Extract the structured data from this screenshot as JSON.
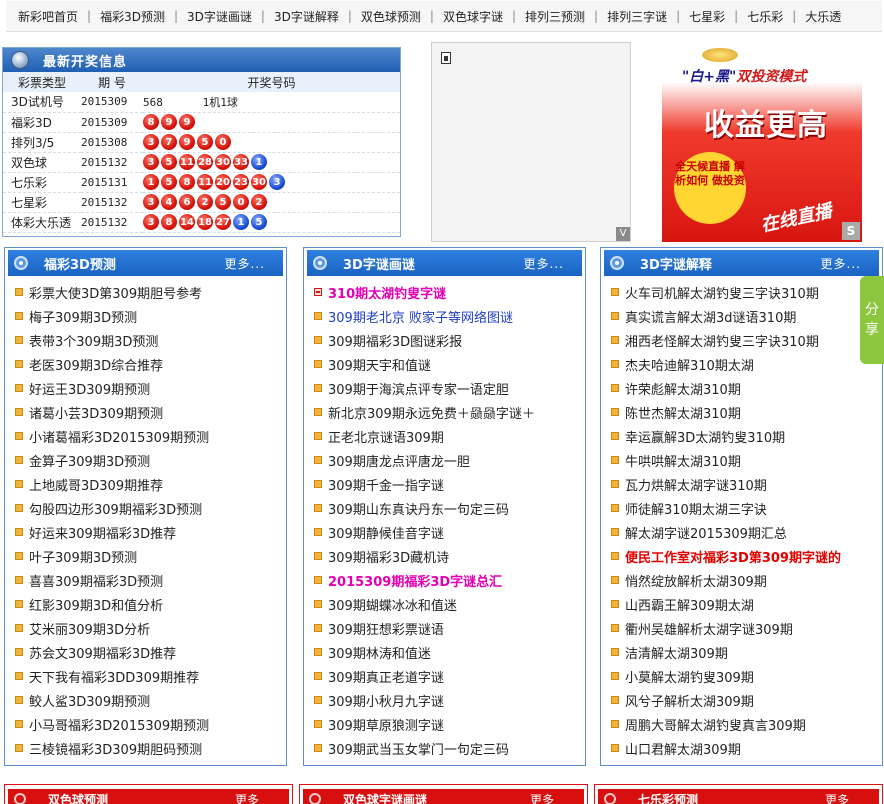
{
  "nav": {
    "items": [
      "新彩吧首页",
      "福彩3D预测",
      "3D字谜画谜",
      "3D字谜解释",
      "双色球预测",
      "双色球字谜",
      "排列三预测",
      "排列三字谜",
      "七星彩",
      "七乐彩",
      "大乐透"
    ],
    "separator": "|"
  },
  "draw_box": {
    "title": "最新开奖信息",
    "headers": [
      "彩票类型",
      "期  号",
      "开奖号码"
    ],
    "rows": [
      {
        "type": "3D试机号",
        "issue": "2015309",
        "plain": "568      1机1球",
        "red": [],
        "blue": []
      },
      {
        "type": "福彩3D",
        "issue": "2015309",
        "plain": "",
        "red": [
          "8",
          "9",
          "9"
        ],
        "blue": []
      },
      {
        "type": "排列3/5",
        "issue": "2015308",
        "plain": "",
        "red": [
          "3",
          "7",
          "9",
          "5",
          "0"
        ],
        "blue": []
      },
      {
        "type": "双色球",
        "issue": "2015132",
        "plain": "",
        "red": [
          "3",
          "5",
          "11",
          "28",
          "30",
          "33"
        ],
        "blue": [
          "1"
        ]
      },
      {
        "type": "七乐彩",
        "issue": "2015131",
        "plain": "",
        "red": [
          "1",
          "5",
          "8",
          "11",
          "20",
          "23",
          "30"
        ],
        "blue": [
          "3"
        ]
      },
      {
        "type": "七星彩",
        "issue": "2015132",
        "plain": "",
        "red": [
          "3",
          "4",
          "6",
          "2",
          "5",
          "0",
          "2"
        ],
        "blue": []
      },
      {
        "type": "体彩大乐透",
        "issue": "2015132",
        "plain": "",
        "red": [
          "3",
          "8",
          "14",
          "18",
          "27"
        ],
        "blue": [
          "1",
          "5"
        ]
      }
    ],
    "ball_colors": {
      "red": "#d8150d",
      "blue": "#1b4fd6"
    }
  },
  "ad": {
    "top_quote": "\"白+黑\"",
    "top_rest": "双投资模式",
    "headline": "收益更高",
    "circle_text": "全天候直播 解析如何 做投资",
    "live": "在线直播",
    "badge": "S"
  },
  "mid_frame": {
    "corner": "V"
  },
  "panels": [
    {
      "title": "福彩3D预测",
      "more": "更多...",
      "items": [
        {
          "text": "彩票大使3D第309期胆号参考",
          "style": ""
        },
        {
          "text": "梅子309期3D预测",
          "style": ""
        },
        {
          "text": "表带3个309期3D预测",
          "style": ""
        },
        {
          "text": "老医309期3D综合推荐",
          "style": ""
        },
        {
          "text": "好运王3D309期预测",
          "style": ""
        },
        {
          "text": "诸葛小芸3D309期预测",
          "style": ""
        },
        {
          "text": "小诸葛福彩3D2015309期预测",
          "style": ""
        },
        {
          "text": "金算子309期3D预测",
          "style": ""
        },
        {
          "text": "上地威哥3D309期推荐",
          "style": ""
        },
        {
          "text": "勾股四边形309期福彩3D预测",
          "style": ""
        },
        {
          "text": "好运来309期福彩3D推荐",
          "style": ""
        },
        {
          "text": "叶子309期3D预测",
          "style": ""
        },
        {
          "text": "喜喜309期福彩3D预测",
          "style": ""
        },
        {
          "text": "红影309期3D和值分析",
          "style": ""
        },
        {
          "text": "艾米丽309期3D分析",
          "style": ""
        },
        {
          "text": "苏会文309期福彩3D推荐",
          "style": ""
        },
        {
          "text": "天下我有福彩3DD309期推荐",
          "style": ""
        },
        {
          "text": "鲛人鲨3D309期预测",
          "style": ""
        },
        {
          "text": "小马哥福彩3D2015309期预测",
          "style": ""
        },
        {
          "text": "三棱镜福彩3D309期胆码预测",
          "style": ""
        }
      ]
    },
    {
      "title": "3D字谜画谜",
      "more": "更多...",
      "items": [
        {
          "text": "310期太湖钓叟字谜",
          "style": "magenta"
        },
        {
          "text": "309期老北京 败家子等网络图谜",
          "style": "blue"
        },
        {
          "text": "309期福彩3D图谜彩报",
          "style": ""
        },
        {
          "text": "309期天宇和值谜",
          "style": ""
        },
        {
          "text": "309期于海滨点评专家一语定胆",
          "style": ""
        },
        {
          "text": "新北京309期永远免费＋赑赑字谜＋",
          "style": ""
        },
        {
          "text": "正老北京谜语309期",
          "style": ""
        },
        {
          "text": "309期唐龙点评唐龙一胆",
          "style": ""
        },
        {
          "text": "309期千金一指字谜",
          "style": ""
        },
        {
          "text": "309期山东真诀丹东一句定三码",
          "style": ""
        },
        {
          "text": "309期静候佳音字谜",
          "style": ""
        },
        {
          "text": "309期福彩3D藏机诗",
          "style": ""
        },
        {
          "text": "2015309期福彩3D字谜总汇",
          "style": "magenta"
        },
        {
          "text": "309期蝴蝶冰冰和值迷",
          "style": ""
        },
        {
          "text": "309期狂想彩票谜语",
          "style": ""
        },
        {
          "text": "309期林涛和值迷",
          "style": ""
        },
        {
          "text": "309期真正老道字谜",
          "style": ""
        },
        {
          "text": "309期小秋月九字谜",
          "style": ""
        },
        {
          "text": "309期草原狼测字谜",
          "style": ""
        },
        {
          "text": "309期武当玉女掌门一句定三码",
          "style": ""
        }
      ]
    },
    {
      "title": "3D字谜解释",
      "more": "更多...",
      "items": [
        {
          "text": "火车司机解太湖钓叟三字诀310期",
          "style": ""
        },
        {
          "text": "真实谎言解太湖3d谜语310期",
          "style": ""
        },
        {
          "text": "湘西老怪解太湖钓叟三字诀310期",
          "style": ""
        },
        {
          "text": "杰夫哈迪解310期太湖",
          "style": ""
        },
        {
          "text": "许荣彪解太湖310期",
          "style": ""
        },
        {
          "text": "陈世杰解太湖310期",
          "style": ""
        },
        {
          "text": "幸运赢解3D太湖钓叟310期",
          "style": ""
        },
        {
          "text": "牛哄哄解太湖310期",
          "style": ""
        },
        {
          "text": "瓦力烘解太湖字谜310期",
          "style": ""
        },
        {
          "text": "师徒解310期太湖三字诀",
          "style": ""
        },
        {
          "text": "解太湖字谜2015309期汇总",
          "style": ""
        },
        {
          "text": "便民工作室对福彩3D第309期字谜的",
          "style": "red"
        },
        {
          "text": "悄然绽放解析太湖309期",
          "style": ""
        },
        {
          "text": "山西霸王解309期太湖",
          "style": ""
        },
        {
          "text": "衢州吴雄解析太湖字谜309期",
          "style": ""
        },
        {
          "text": "洁清解太湖309期",
          "style": ""
        },
        {
          "text": "小莫解太湖钓叟309期",
          "style": ""
        },
        {
          "text": "风兮子解析太湖309期",
          "style": ""
        },
        {
          "text": "周鹏大哥解太湖钓叟真言309期",
          "style": ""
        },
        {
          "text": "山口君解太湖309期",
          "style": ""
        }
      ]
    }
  ],
  "share": {
    "label_1": "分",
    "label_2": "享",
    "color": "#8dc63f"
  },
  "bottom_panels": [
    {
      "title": "双色球预测",
      "more": "更多"
    },
    {
      "title": "双色球字谜画谜",
      "more": "更多"
    },
    {
      "title": "七乐彩预测",
      "more": "更多"
    }
  ],
  "colors": {
    "panel_blue": "#1a63c2",
    "bottom_red": "#d70f0f",
    "magenta": "#e400b5",
    "red": "#e00000"
  }
}
